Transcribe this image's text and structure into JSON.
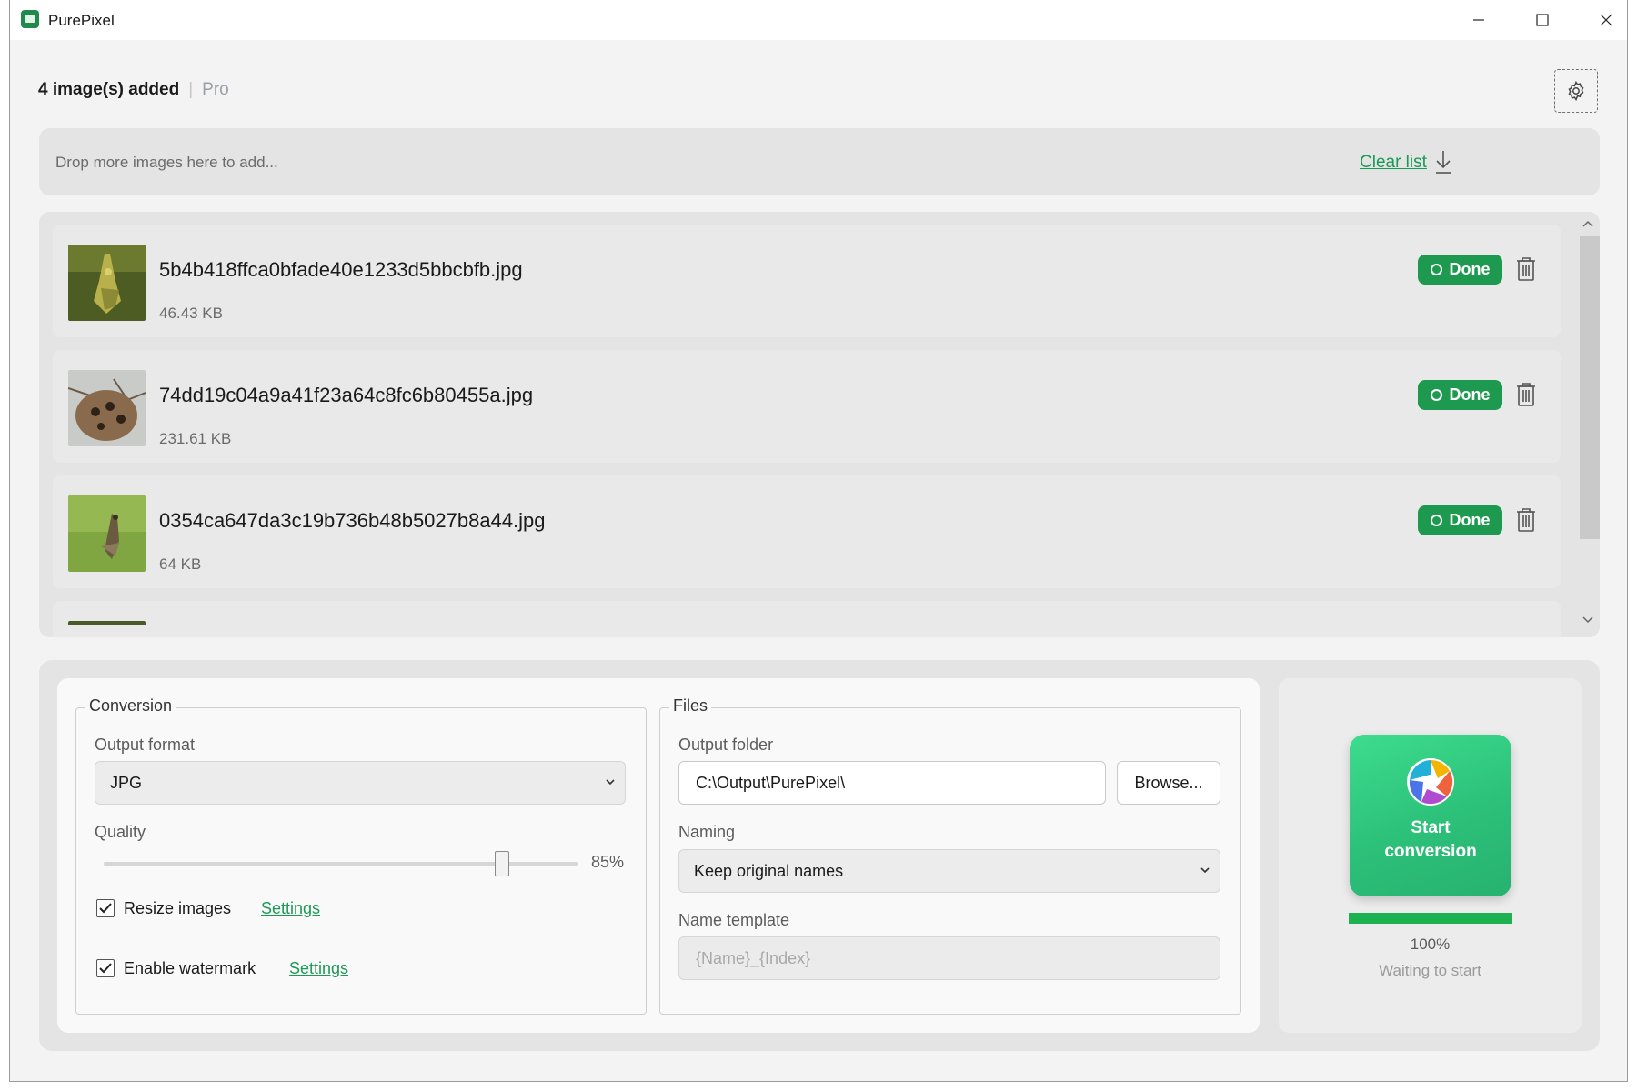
{
  "app": {
    "title": "PurePixel"
  },
  "header": {
    "count_text": "4 image(s) added",
    "separator": "|",
    "edition": "Pro"
  },
  "drop_zone": {
    "hint": "Drop more images here to add...",
    "clear_label": "Clear list"
  },
  "files": [
    {
      "name": "5b4b418ffca0bfade40e1233d5bbcbfb.jpg",
      "size": "46.43 KB",
      "status": "Done"
    },
    {
      "name": "74dd19c04a9a41f23a64c8fc6b80455a.jpg",
      "size": "231.61 KB",
      "status": "Done"
    },
    {
      "name": "0354ca647da3c19b736b48b5027b8a44.jpg",
      "size": "64 KB",
      "status": "Done"
    }
  ],
  "conversion": {
    "legend": "Conversion",
    "output_format_label": "Output format",
    "output_format_value": "JPG",
    "quality_label": "Quality",
    "quality_value": "85%",
    "quality_fraction": 0.85,
    "resize_label": "Resize images",
    "resize_checked": true,
    "resize_settings": "Settings",
    "watermark_label": "Enable watermark",
    "watermark_checked": true,
    "watermark_settings": "Settings"
  },
  "file_settings": {
    "legend": "Files",
    "output_folder_label": "Output folder",
    "output_folder_value": "C:\\Output\\PurePixel\\",
    "browse_label": "Browse...",
    "naming_label": "Naming",
    "naming_value": "Keep original names",
    "template_label": "Name template",
    "template_placeholder": "{Name}_{Index}"
  },
  "action": {
    "start_label": "Start conversion",
    "progress_text": "100%",
    "progress_fraction": 1.0,
    "status_text": "Waiting to start"
  },
  "colors": {
    "accent": "#1e9a50",
    "link": "#1a9a55",
    "progress": "#1eb14f"
  },
  "icons": [
    "app-icon",
    "minimize-icon",
    "maximize-icon",
    "close-icon",
    "gear-icon",
    "download-icon",
    "trash-icon",
    "chevron-up-icon",
    "chevron-down-icon",
    "checkmark-icon",
    "aperture-icon"
  ]
}
